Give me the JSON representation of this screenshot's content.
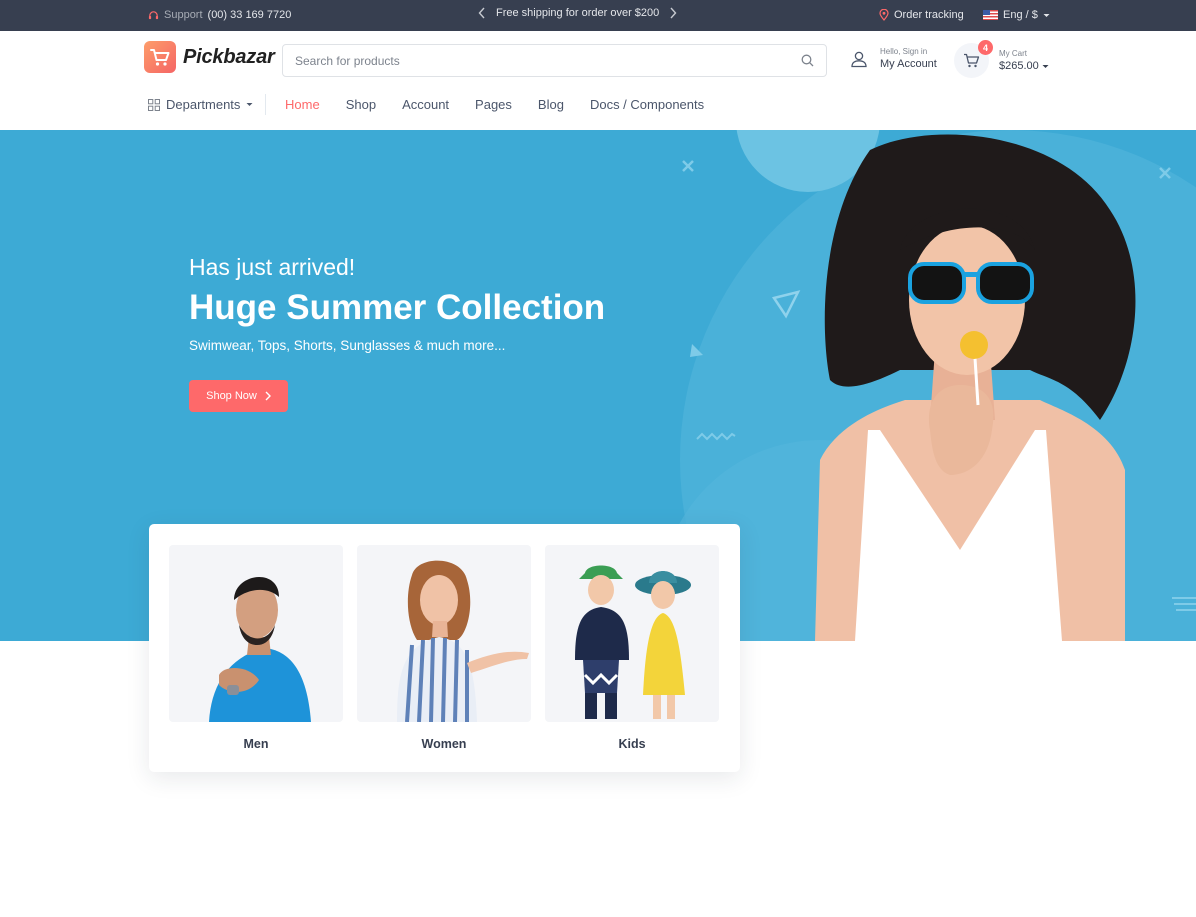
{
  "topbar": {
    "support_label": "Support",
    "support_phone": "(00) 33 169 7720",
    "promo": "Free shipping for order over $200",
    "order_tracking": "Order tracking",
    "language": "Eng / $"
  },
  "header": {
    "brand": "Pickbazar",
    "search_placeholder": "Search for products",
    "account_greeting": "Hello, Sign in",
    "account_label": "My Account",
    "cart_count": "4",
    "cart_label": "My Cart",
    "cart_total": "$265.00"
  },
  "nav": {
    "departments": "Departments",
    "links": [
      "Home",
      "Shop",
      "Account",
      "Pages",
      "Blog",
      "Docs / Components"
    ],
    "active": "Home"
  },
  "hero": {
    "subtitle": "Has just arrived!",
    "title": "Huge Summer Collection",
    "description": "Swimwear, Tops, Shorts, Sunglasses & much more...",
    "cta": "Shop Now",
    "background_color": "#3daad5"
  },
  "categories": [
    {
      "label": "Men"
    },
    {
      "label": "Women"
    },
    {
      "label": "Kids"
    }
  ],
  "colors": {
    "accent": "#fe696a",
    "topbar": "#373f50"
  }
}
